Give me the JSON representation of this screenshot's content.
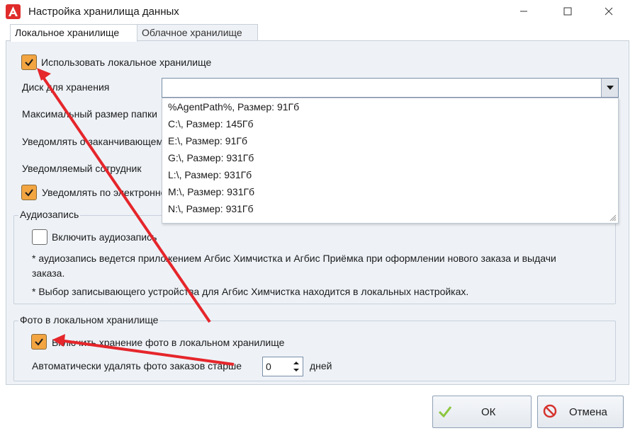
{
  "window": {
    "title": "Настройка хранилища данных",
    "accent_color": "#e02b2b"
  },
  "tabs": [
    {
      "label": "Локальное хранилище",
      "active": true
    },
    {
      "label": "Облачное хранилище",
      "active": false
    }
  ],
  "local": {
    "use_local_label": "Использовать локальное хранилище",
    "disk_label": "Диск для хранения",
    "max_size_label": "Максимальный размер папки",
    "notify_ending_label": "Уведомлять о заканчивающемся месте",
    "notified_employee_label": "Уведомляемый сотрудник",
    "notify_email_label": "Уведомлять по электронной почте",
    "disk_value": ""
  },
  "dropdown": {
    "items": [
      "%AgentPath%, Размер: 91Гб",
      "C:\\, Размер: 145Гб",
      "E:\\, Размер: 91Гб",
      "G:\\, Размер: 931Гб",
      "L:\\, Размер: 931Гб",
      "M:\\, Размер: 931Гб",
      "N:\\, Размер: 931Гб"
    ]
  },
  "audio": {
    "legend": "Аудиозапись",
    "enable_label": "Включить аудиозапись",
    "note1_line1": "* аудиозапись ведется приложением Агбис Химчистка и Агбис Приёмка при оформлении нового заказа и выдачи",
    "note1_line2": "заказа.",
    "note2": "* Выбор записывающего устройства для Агбис Химчистка находится в локальных настройках."
  },
  "photo": {
    "legend": "Фото в локальном хранилище",
    "enable_label": "Включить хранение фото в локальном хранилище",
    "auto_delete_label": "Автоматически удалять фото заказов старше",
    "days_value": "0",
    "days_unit": "дней"
  },
  "buttons": {
    "ok": "ОК",
    "cancel": "Отмена"
  },
  "colors": {
    "checkbox_checked": "#f2a541",
    "annotation_arrow": "#e5262b",
    "ok_check": "#8cc63f",
    "cancel_icon": "#d6332e"
  }
}
